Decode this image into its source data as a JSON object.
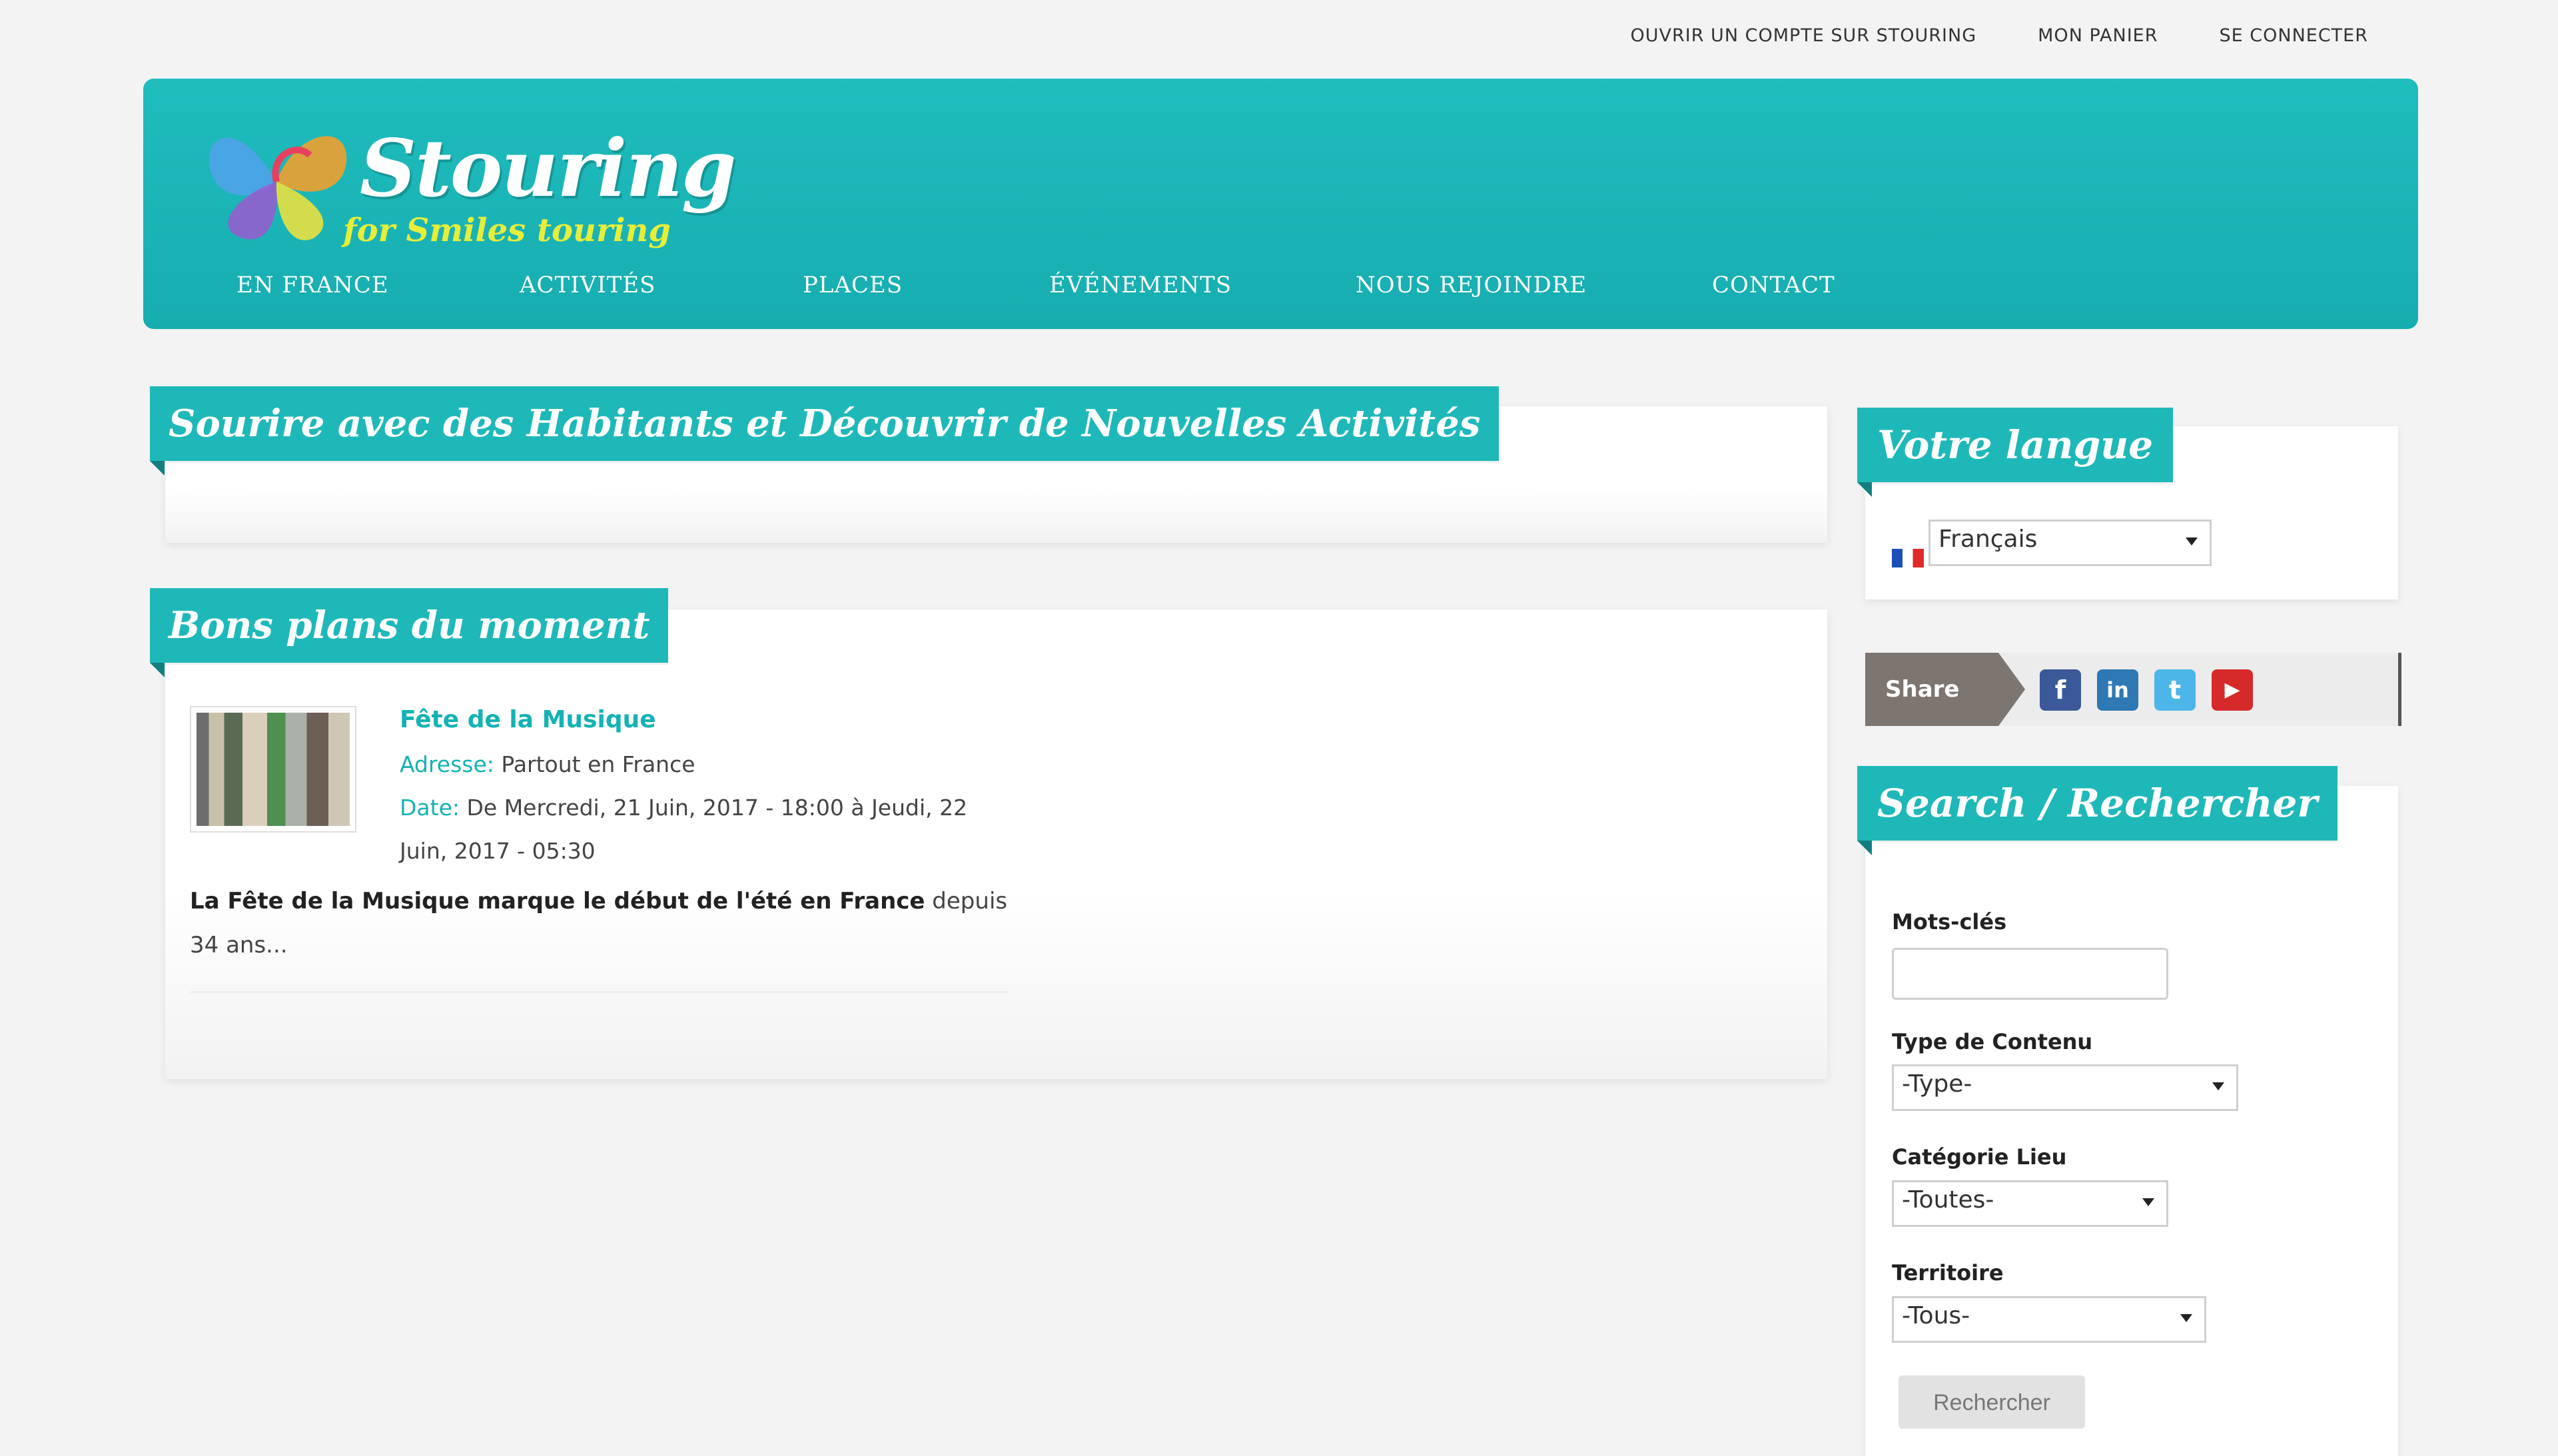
{
  "top_links": [
    "OUVRIR UN COMPTE SUR STOURING",
    "MON PANIER",
    "SE CONNECTER"
  ],
  "logo": {
    "title": "Stouring",
    "subtitle": "for Smiles touring"
  },
  "nav": [
    "EN FRANCE",
    "ACTIVITÉS",
    "PLACES",
    "ÉVÉNEMENTS",
    "NOUS REJOINDRE",
    "CONTACT"
  ],
  "main": {
    "banner_title": "Sourire avec des Habitants et Découvrir de Nouvelles Activités",
    "deals_title": "Bons plans du moment",
    "event": {
      "title": "Fête de la Musique",
      "address_label": "Adresse:",
      "address": "Partout en France",
      "date_label": "Date:",
      "date": "De Mercredi, 21 Juin, 2017 - 18:00 à Jeudi, 22",
      "date_cont": "Juin, 2017 - 05:30",
      "desc_bold": "La Fête de la Musique marque le début de l'été en France",
      "desc_rest": " depuis 34 ans..."
    }
  },
  "sidebar": {
    "language_title": "Votre langue",
    "language_value": "Français",
    "share_label": "Share",
    "social": [
      {
        "name": "facebook-icon",
        "glyph": "f",
        "color": "#3b5998"
      },
      {
        "name": "linkedin-icon",
        "glyph": "in",
        "color": "#2e78b4"
      },
      {
        "name": "twitter-icon",
        "glyph": "t",
        "color": "#4db6e8"
      },
      {
        "name": "youtube-icon",
        "glyph": "▶",
        "color": "#d62a2a"
      }
    ],
    "search_title": "Search / Rechercher",
    "keywords_label": "Mots-clés",
    "content_type_label": "Type de Contenu",
    "content_type_value": "-Type-",
    "place_category_label": "Catégorie Lieu",
    "place_category_value": "-Toutes-",
    "territory_label": "Territoire",
    "territory_value": "-Tous-",
    "search_button": "Rechercher"
  }
}
